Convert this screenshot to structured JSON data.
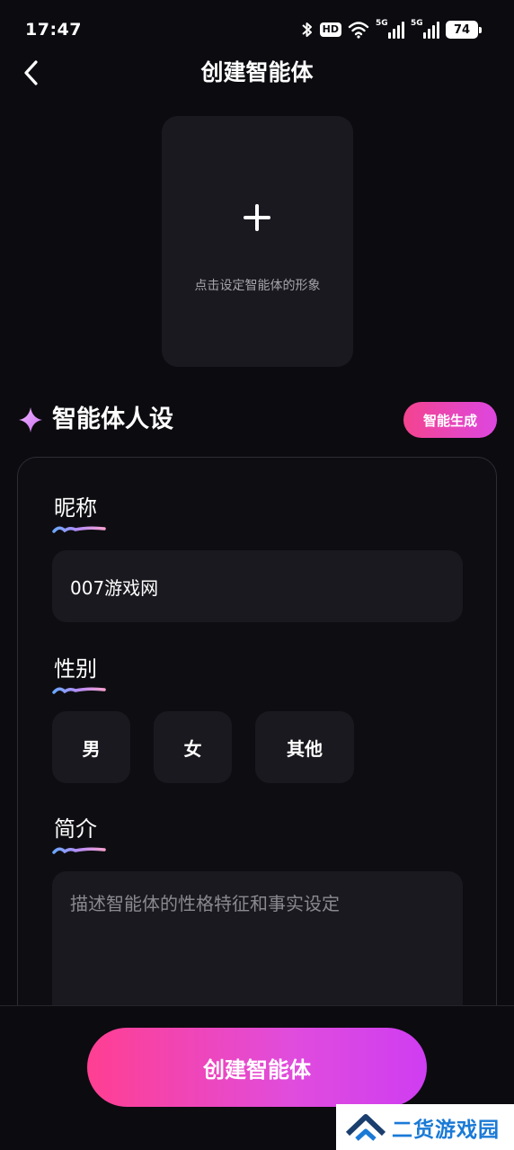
{
  "status_bar": {
    "time": "17:47",
    "hd_label": "HD",
    "signal_1_label": "5G",
    "signal_2_label": "5G",
    "battery": "74"
  },
  "header": {
    "title": "创建智能体",
    "back_icon": "chevron-left-icon"
  },
  "avatar": {
    "hint": "点击设定智能体的形象",
    "icon": "plus-icon"
  },
  "persona": {
    "title": "智能体人设",
    "icon": "sparkle-icon",
    "ai_generate_label": "智能生成"
  },
  "form": {
    "nickname_label": "昵称",
    "nickname_value": "007游戏网",
    "gender_label": "性别",
    "gender_options": [
      "男",
      "女",
      "其他"
    ],
    "intro_label": "简介",
    "intro_placeholder": "描述智能体的性格特征和事实设定"
  },
  "footer": {
    "create_label": "创建智能体"
  },
  "watermark": {
    "text": "二货游戏园"
  },
  "colors": {
    "background": "#0c0b10",
    "surface": "#1a191f",
    "accent_pink": "#ff3f92",
    "accent_purple": "#cf3df2",
    "watermark_blue": "#1a7ad6"
  }
}
